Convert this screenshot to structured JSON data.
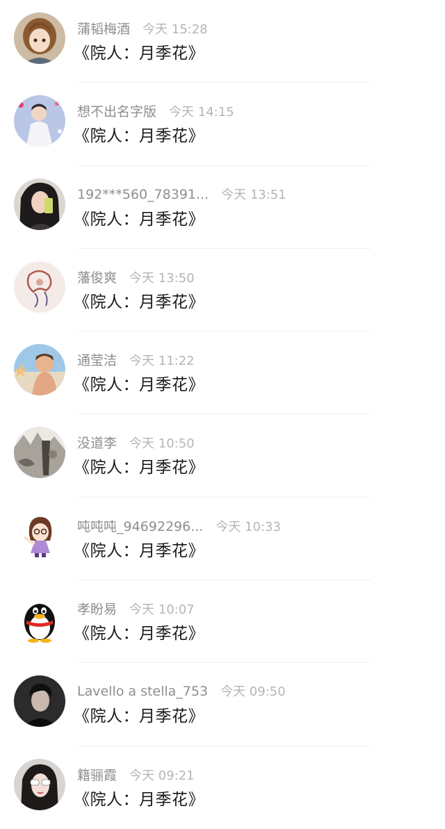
{
  "comments": [
    {
      "name": "蒲韬梅酒",
      "time": "今天 15:28",
      "text": "《院人：月季花》",
      "avatar": "anime-girl-avatar-icon"
    },
    {
      "name": "想不出名字版",
      "time": "今天 14:15",
      "text": "《院人：月季花》",
      "avatar": "singer-photo-avatar-icon"
    },
    {
      "name": "192***560_78391...",
      "time": "今天 13:51",
      "text": "《院人：月季花》",
      "avatar": "selfie-girl-avatar-icon"
    },
    {
      "name": "藩俊爽",
      "time": "今天 13:50",
      "text": "《院人：月季花》",
      "avatar": "ink-drawing-avatar-icon"
    },
    {
      "name": "通莹洁",
      "time": "今天 11:22",
      "text": "《院人：月季花》",
      "avatar": "child-beach-avatar-icon"
    },
    {
      "name": "没道李",
      "time": "今天 10:50",
      "text": "《院人：月季花》",
      "avatar": "ink-painting-avatar-icon"
    },
    {
      "name": "吨吨吨_94692296...",
      "time": "今天 10:33",
      "text": "《院人：月季花》",
      "avatar": "cartoon-girl-avatar-icon"
    },
    {
      "name": "孝盼易",
      "time": "今天 10:07",
      "text": "《院人：月季花》",
      "avatar": "penguin-avatar-icon"
    },
    {
      "name": "Lavello a stella_753",
      "time": "今天 09:50",
      "text": "《院人：月季花》",
      "avatar": "man-portrait-avatar-icon"
    },
    {
      "name": "籍骊霞",
      "time": "今天 09:21",
      "text": "《院人：月季花》",
      "avatar": "sunglasses-girl-avatar-icon"
    }
  ]
}
